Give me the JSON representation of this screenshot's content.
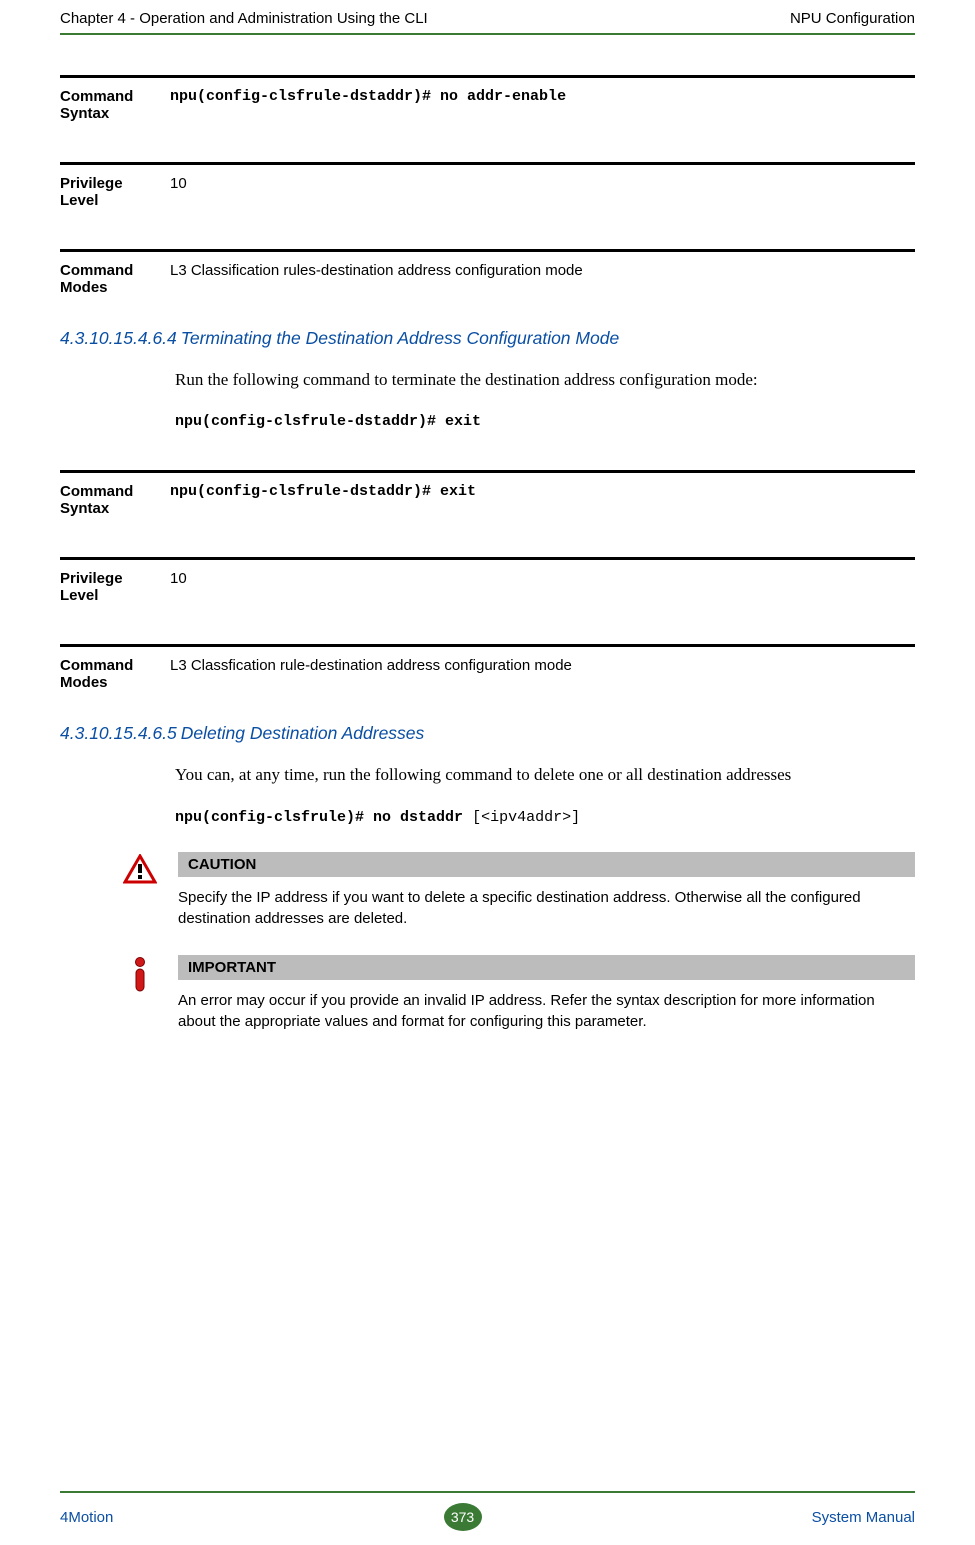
{
  "header": {
    "left": "Chapter 4 - Operation and Administration Using the CLI",
    "right": "NPU Configuration"
  },
  "block1": {
    "syntax_label": "Command Syntax",
    "syntax_val": "npu(config-clsfrule-dstaddr)# no addr-enable",
    "priv_label": "Privilege Level",
    "priv_val": "10",
    "modes_label": "Command Modes",
    "modes_val": "L3 Classification rules-destination address configuration mode"
  },
  "sec1": {
    "num": "4.3.10.15.4.6.4",
    "title": "Terminating the Destination Address Configuration Mode",
    "para": "Run the following command to terminate the destination address configuration mode:",
    "cmd": "npu(config-clsfrule-dstaddr)# exit"
  },
  "block2": {
    "syntax_label": "Command Syntax",
    "syntax_val": "npu(config-clsfrule-dstaddr)# exit",
    "priv_label": "Privilege Level",
    "priv_val": "10",
    "modes_label": "Command Modes",
    "modes_val": "L3 Classfication rule-destination address configuration mode"
  },
  "sec2": {
    "num": "4.3.10.15.4.6.5",
    "title": "Deleting Destination Addresses",
    "para": " You can, at any time, run the following command to delete one or all destination addresses",
    "cmd_bold": "npu(config-clsfrule)# no dstaddr ",
    "cmd_opt": "[<ipv4addr>]"
  },
  "caution": {
    "title": "CAUTION",
    "text": "Specify the IP address  if you want to delete a specific destination address. Otherwise all the configured destination addresses are deleted."
  },
  "important": {
    "title": "IMPORTANT",
    "text": "An error may occur if you provide an invalid IP address. Refer the syntax description for more information about the appropriate values and format for configuring this parameter."
  },
  "footer": {
    "left": "4Motion",
    "page": "373",
    "right": "System Manual"
  }
}
